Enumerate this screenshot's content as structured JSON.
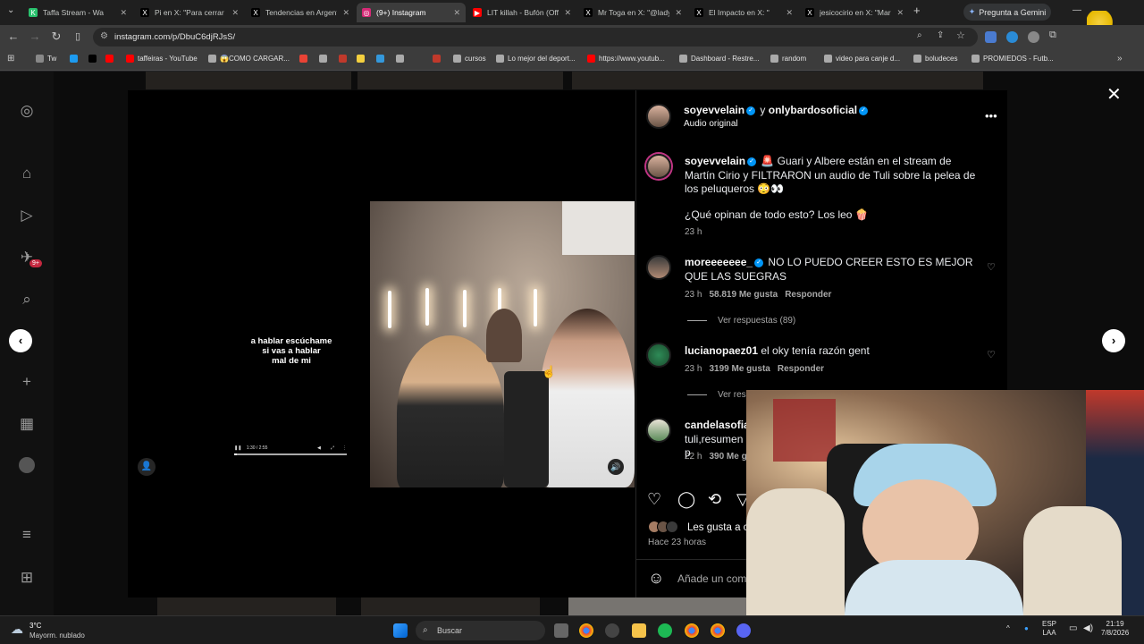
{
  "browser": {
    "tabs": [
      {
        "title": "Taffa Stream - Wa",
        "color": "#29c26e",
        "glyph": "K"
      },
      {
        "title": "Pi en X: \"Para cerrar d",
        "color": "#000000",
        "glyph": "X"
      },
      {
        "title": "Tendencias en Argent",
        "color": "#000000",
        "glyph": "X"
      },
      {
        "title": "(9+) Instagram",
        "color": "#d62976",
        "glyph": "◎"
      },
      {
        "title": "LIT killah - Bufón (Off",
        "color": "#ff0000",
        "glyph": "▶"
      },
      {
        "title": "Mr Toga en X: \"@lady",
        "color": "#000000",
        "glyph": "X"
      },
      {
        "title": "El Impacto en X: \"",
        "color": "#000000",
        "glyph": "X"
      },
      {
        "title": "jesicocirio en X: \"Mar",
        "color": "#000000",
        "glyph": "X"
      }
    ],
    "active_tab_index": 3,
    "new_tab": "+",
    "gemini_label": "Pregunta a Gemini",
    "url": "instagram.com/p/DbuC6djRJsS/",
    "bookmarks": [
      {
        "label": "Tw",
        "color": "#888888"
      },
      {
        "label": "",
        "color": "#1d9bf0"
      },
      {
        "label": "",
        "color": "#000000"
      },
      {
        "label": "",
        "color": "#ff0000"
      },
      {
        "label": "taffeiras - YouTube",
        "color": "#ff0000"
      },
      {
        "label": "😱COMO CARGAR...",
        "color": "#aaaaaa"
      },
      {
        "label": "",
        "color": "#ea4335"
      },
      {
        "label": "",
        "color": "#aaaaaa"
      },
      {
        "label": "",
        "color": "#c0392b"
      },
      {
        "label": "",
        "color": "#f4d03f"
      },
      {
        "label": "",
        "color": "#3498db"
      },
      {
        "label": "",
        "color": "#aaaaaa"
      },
      {
        "label": "",
        "color": "#c0392b"
      },
      {
        "label": "cursos",
        "color": "#aaaaaa"
      },
      {
        "label": "Lo mejor del deport...",
        "color": "#aaaaaa"
      },
      {
        "label": "https://www.youtub...",
        "color": "#ff0000"
      },
      {
        "label": "Dashboard - Restre...",
        "color": "#aaaaaa"
      },
      {
        "label": "random",
        "color": "#aaaaaa"
      },
      {
        "label": "video para canje d...",
        "color": "#aaaaaa"
      },
      {
        "label": "boludeces",
        "color": "#aaaaaa"
      },
      {
        "label": "PROMIEDOS - Futb...",
        "color": "#aaaaaa"
      }
    ]
  },
  "sidebar": {
    "badge": "9+"
  },
  "video": {
    "caption_lines": [
      "a hablar escúchame",
      "si vas a hablar",
      "mal de mi"
    ],
    "time": "1:30 / 2:55",
    "progress": 0.02
  },
  "post": {
    "header": {
      "user": "soyevvelain",
      "connector": "y",
      "collab": "onlybardosoficial",
      "audio": "Audio original"
    },
    "caption": {
      "user": "soyevvelain",
      "text": "🚨 Guari y Albere están en el stream de Martín Cirio y FILTRARON un audio de Tuli sobre la pelea de los peluqueros 😳👀",
      "text2": "¿Qué opinan de todo esto? Los leo 🍿",
      "time": "23 h"
    },
    "comments": [
      {
        "user": "moreeeeeee_",
        "text": "NO LO PUEDO CREER ESTO ES MEJOR QUE LAS SUEGRAS",
        "time": "23 h",
        "likes": "58.819 Me gusta",
        "reply": "Responder",
        "replies": "Ver respuestas (89)",
        "verified": true
      },
      {
        "user": "lucianopaez01",
        "text": "el oky tenía razón gent",
        "time": "23 h",
        "likes": "3199 Me gusta",
        "reply": "Responder",
        "replies": "Ver resp",
        "verified": false
      },
      {
        "user": "candelasofiaa",
        "text": "tuli,resumen p",
        "time": "22 h",
        "likes": "390 Me g",
        "reply": "",
        "replies": "",
        "verified": false
      }
    ],
    "liked_by": "Les gusta a c",
    "posted": "Hace 23 horas",
    "add_comment": "Añade un come"
  },
  "taskbar": {
    "weather_temp": "3°C",
    "weather_desc": "Mayorm. nublado",
    "search": "Buscar",
    "lang_top": "ESP",
    "lang_bottom": "LAA",
    "time": "21:19",
    "date": "7/8/2026"
  }
}
